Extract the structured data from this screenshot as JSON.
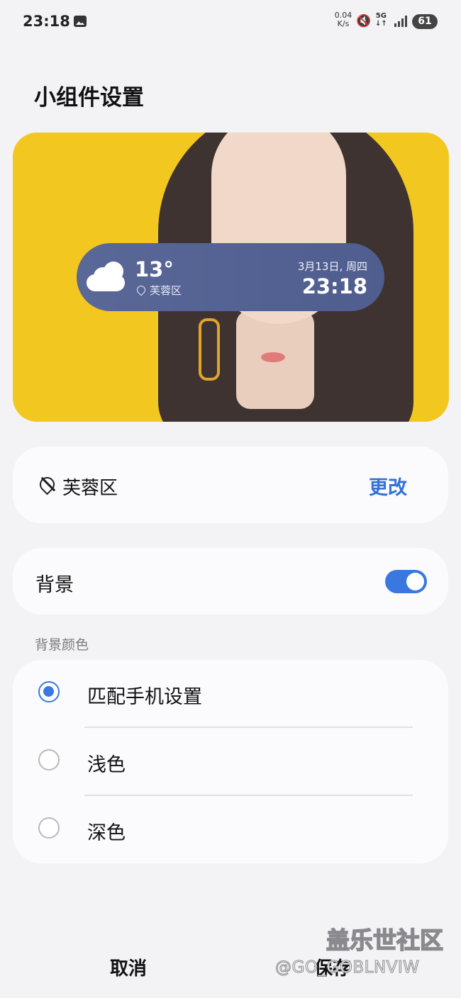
{
  "status_bar": {
    "time": "23:18",
    "speed_value": "0.04",
    "speed_unit": "K/s",
    "net_type": "5G",
    "net_arrows": "↓↑",
    "battery": "61",
    "icons": [
      "gallery-icon",
      "mute-icon",
      "signal-icon"
    ]
  },
  "page": {
    "title": "小组件设置"
  },
  "widget": {
    "weather_icon": "cloud-icon",
    "temperature": "13°",
    "location": "芙蓉区",
    "date": "3月13日, 周四",
    "time": "23:18"
  },
  "location_card": {
    "name": "芙蓉区",
    "change_label": "更改"
  },
  "background_card": {
    "label": "背景",
    "enabled": true
  },
  "color_section": {
    "label": "背景颜色",
    "options": [
      {
        "label": "匹配手机设置",
        "selected": true
      },
      {
        "label": "浅色",
        "selected": false
      },
      {
        "label": "深色",
        "selected": false
      }
    ]
  },
  "actions": {
    "cancel_label": "取消",
    "save_label": "保存"
  },
  "watermark": {
    "main": "盖乐世社区",
    "sub": "@GO_GOBLNVIW"
  },
  "colors": {
    "accent": "#3a78e0",
    "change_link": "#3470d6",
    "widget_bg": "#55639a",
    "preview_bg": "#f2c71f"
  }
}
